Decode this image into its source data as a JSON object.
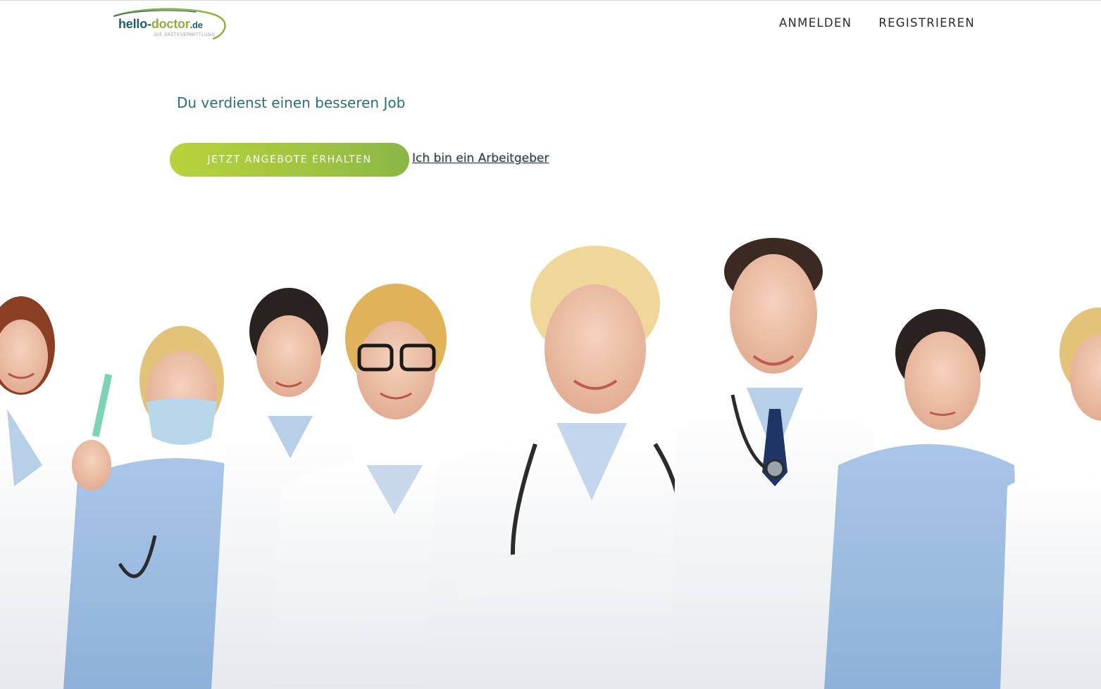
{
  "header": {
    "logo": {
      "word_hello": "hello-",
      "word_doctor": "doctor",
      "word_tld": ".de",
      "tagline": "DIE ÄRZTEVERMITTLUNG"
    },
    "nav": [
      {
        "label": "ANMELDEN"
      },
      {
        "label": "REGISTRIEREN"
      }
    ]
  },
  "hero": {
    "headline": "Du verdienst einen besseren Job",
    "cta_label": "JETZT ANGEBOTE ERHALTEN",
    "employer_link": "Ich bin ein Arbeitgeber",
    "photo_subject": "group-of-doctors-and-nurses"
  },
  "colors": {
    "brand_teal": "#1f5f6b",
    "brand_green": "#8cb13a",
    "headline": "#2a6f77",
    "cta_gradient_start": "#b7d23c",
    "cta_gradient_end": "#8ab646"
  }
}
